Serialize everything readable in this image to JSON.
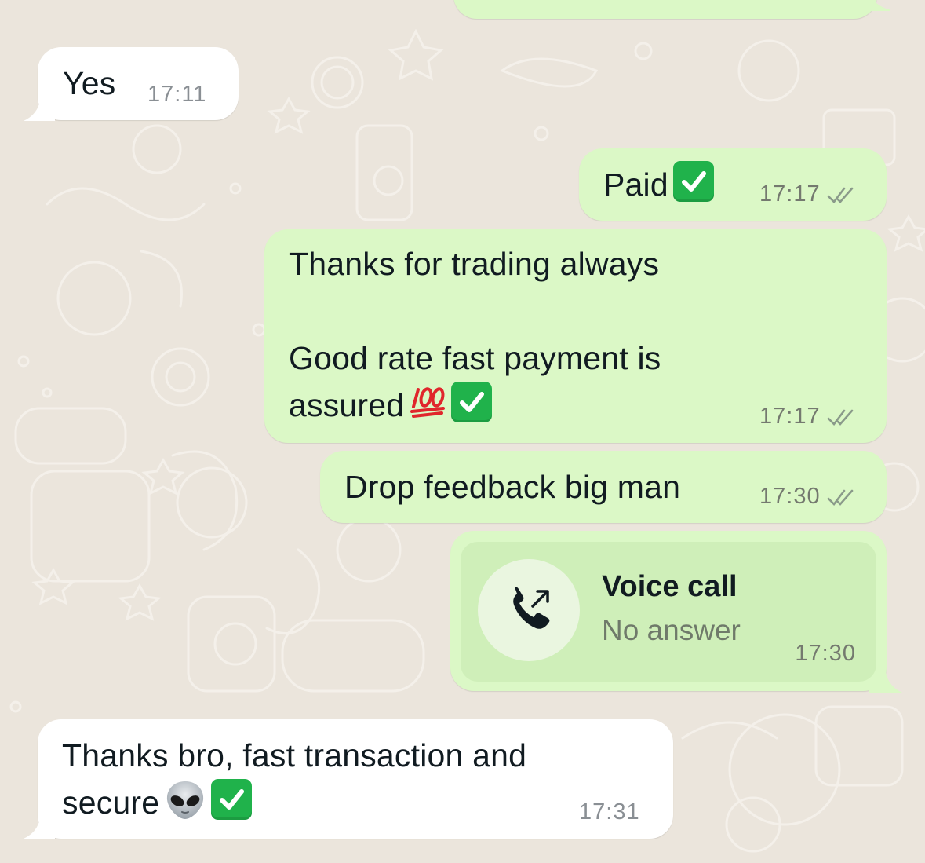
{
  "colors": {
    "wallpaper": "#ebe5dc",
    "incoming_bubble": "#ffffff",
    "outgoing_bubble": "#dbf8c6",
    "call_card": "#cfefb9",
    "check_emoji": "#20b24b"
  },
  "messages": [
    {
      "direction": "incoming",
      "text": "Yes",
      "time": "17:11"
    },
    {
      "direction": "outgoing",
      "text": "Paid",
      "emoji": "white-heavy-check-mark",
      "time": "17:17",
      "status": "double-check-read"
    },
    {
      "direction": "outgoing",
      "line1": "Thanks for trading always",
      "line2": "Good rate fast payment is",
      "line3": "assured",
      "emoji": [
        "hundred-points",
        "white-heavy-check-mark"
      ],
      "time": "17:17",
      "status": "double-check-read"
    },
    {
      "direction": "outgoing",
      "text": "Drop feedback big man",
      "time": "17:30",
      "status": "double-check-read"
    },
    {
      "direction": "outgoing",
      "type": "call",
      "title": "Voice call",
      "subtitle": "No answer",
      "icon": "outgoing-call-icon",
      "time": "17:30"
    },
    {
      "direction": "incoming",
      "line1": "Thanks bro, fast transaction and",
      "line2": "secure",
      "emoji": [
        "alien",
        "white-heavy-check-mark"
      ],
      "time": "17:31"
    }
  ]
}
